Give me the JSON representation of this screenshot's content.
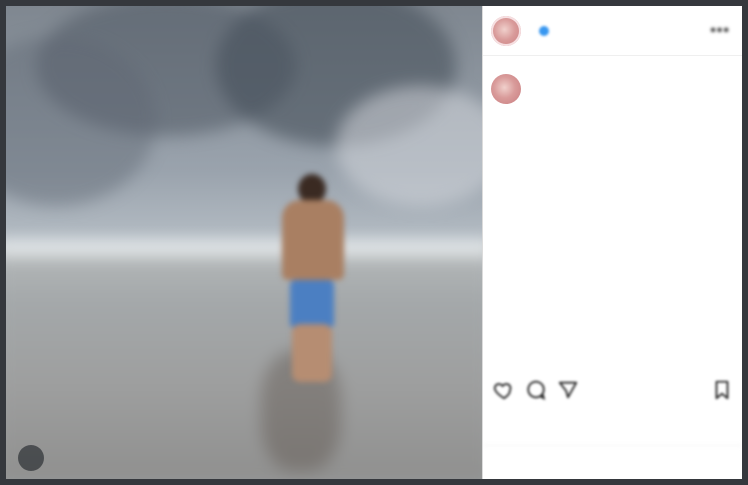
{
  "post": {
    "username": "",
    "follow_label": "",
    "more_label": "•••",
    "caption_username": "",
    "caption_lines": [
      "",
      "",
      "",
      "",
      "",
      "",
      "",
      "",
      "",
      "",
      "",
      "",
      "",
      "",
      "",
      "",
      "",
      "",
      ""
    ],
    "likes_text": "",
    "timestamp": "",
    "comment_placeholder": ""
  },
  "colors": {
    "accent": "#3897f0",
    "text": "#262626",
    "muted": "#8e8e8e",
    "panel_bg": "#ffffff"
  },
  "icons": {
    "like": "heart-icon",
    "comment": "comment-icon",
    "share": "share-icon",
    "save": "bookmark-icon",
    "media": "photo-icon"
  }
}
